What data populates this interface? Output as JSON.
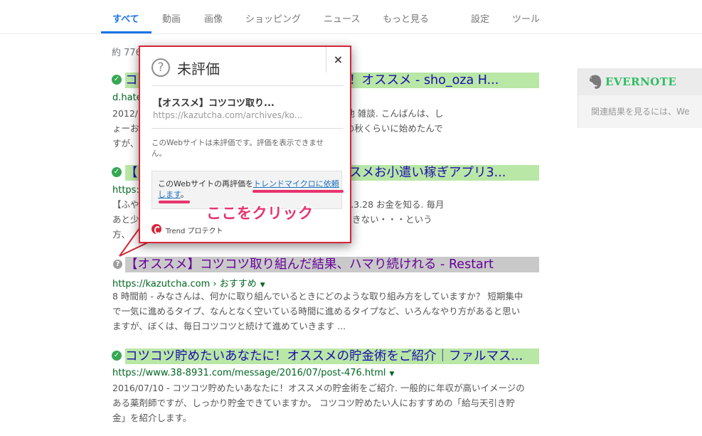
{
  "nav": {
    "items": [
      "すべて",
      "動画",
      "画像",
      "ショッピング",
      "ニュース",
      "もっと見る",
      "設定",
      "ツール"
    ],
    "active_index": 0
  },
  "stats": "約 776",
  "results": [
    {
      "status": "safe",
      "title": "コ　　　　　　　　　　　　　　いける！オススメ - sho_oza H...",
      "url": "d.hate",
      "snippet_lines": [
        "2012/(　　　　　　　　　　　　　　る！オススメ・その他 雑談. こんばんは、し",
        "ょーお　　　　　　　　　　　　　　。 100円貯金を去年の秋くらいに始めたんで",
        "すが、"
      ]
    },
    {
      "status": "safe",
      "title": "【　　　　　　　　　　　　　　　オススメお小遣い稼ぎアプリ3...",
      "url": "https:/",
      "snippet_lines": [
        "【ふや　　　　　　　　　　　　　　稼ぎアプリ3選. 2017.3.28 お金を知る. 毎月",
        "あと少　　　　　　　　　　　　　　しくて難しいことはできない・・・という",
        "方、　　　　　　　　　　　　　　　存知ですか？"
      ]
    },
    {
      "status": "unrated",
      "title": "【オススメ】コツコツ取り組んだ結果、ハマり続けれる - Restart",
      "url": "https://kazutcha.com › おすすめ",
      "date": "8 時間前",
      "snippet_lines": [
        "8 時間前 - みなさんは、何かに取り組んでいるときにどのような取り組み方をしていますか？ 短期集中",
        "で一気に進めるタイプ、なんとなく空いている時間に進めるタイプなど、いろんなやり方があると思い",
        "ますが、ぼくは、毎日コツコツと続けて進めていきます ..."
      ]
    },
    {
      "status": "safe",
      "title": "コツコツ貯めたいあなたに！オススメの貯金術をご紹介｜ファルマス...",
      "url": "https://www.38-8931.com/message/2016/07/post-476.html",
      "date": "2016/07/10",
      "snippet_lines": [
        "2016/07/10 - コツコツ貯めたいあなたに！オススメの貯金術をご紹介. 一般的に年収が高いイメージの",
        "ある薬剤師ですが、しっかり貯金できていますか。 コツコツ貯めたい人におすすめの「給与天引き貯",
        "金」を紹介します。"
      ]
    }
  ],
  "evernote": {
    "name": "EVERNOTE",
    "text": "関連結果を見るには、We"
  },
  "popup": {
    "title": "未評価",
    "close": "×",
    "page_title": "【オススメ】コツコツ取り...",
    "page_url": "https://kazutcha.com/archives/ko...",
    "message": "このWebサイトは未評価です。評価を表示できません。",
    "box_text_before": "このWebサイトの再評価を",
    "box_link": "トレンドマイクロに依頼します",
    "box_text_after": "。",
    "footer": "Trend プロテクト"
  },
  "annotation": "ここをクリック",
  "colors": {
    "accent_blue": "#1a73e8",
    "highlight_green": "#b9e7a6",
    "highlight_grey": "#c9c9c9",
    "popup_border": "#d6273b",
    "annotation_pink": "#e8336d",
    "evernote_green": "#2dbe60"
  }
}
